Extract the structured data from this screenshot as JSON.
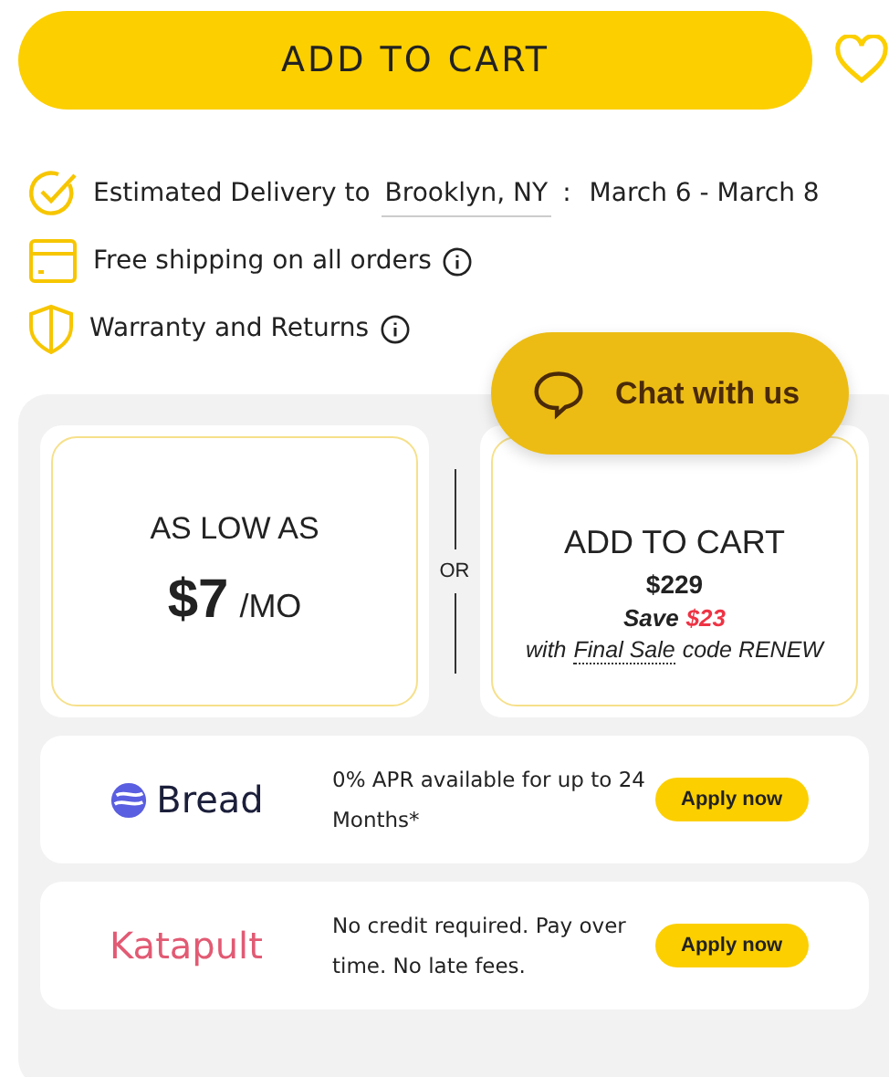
{
  "add_to_cart": {
    "label": "ADD TO CART"
  },
  "wishlist": {
    "selected": false
  },
  "features": [
    {
      "kind": "check",
      "text": "Estimated Delivery to",
      "location": "Brooklyn, NY",
      "separator": ":",
      "dates": "March 6 - March 8",
      "info": false
    },
    {
      "kind": "box",
      "text": "Free shipping on all orders",
      "info": true
    },
    {
      "kind": "shield",
      "text": "Warranty and Returns",
      "info": true
    }
  ],
  "financing": {
    "monthly": {
      "label": "AS LOW AS",
      "price": "$7",
      "unit": "/MO"
    },
    "divider": "OR",
    "buy": {
      "title": "ADD TO CART",
      "price": "$229",
      "save_label": "Save",
      "save_amount": "$23",
      "code_prefix": "with",
      "code_link": "Final Sale",
      "code_suffix": "code RENEW"
    },
    "providers": [
      {
        "kind": "bread",
        "name": "Bread",
        "text": "0% APR available for up to 24 Months*",
        "button": "Apply now"
      },
      {
        "kind": "katapult",
        "name": "Katapult",
        "text": "No credit required. Pay over time. No late fees.",
        "button": "Apply now"
      }
    ]
  },
  "chat": {
    "label": "Chat with us"
  }
}
